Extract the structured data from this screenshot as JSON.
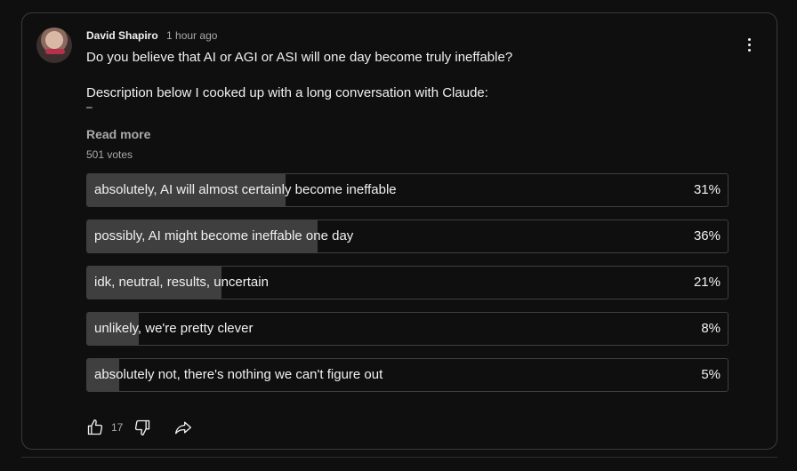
{
  "post": {
    "author": "David Shapiro",
    "time": "1 hour ago",
    "line1": "Do you believe that AI or AGI or ASI will one day become truly ineffable?",
    "line2": "Description below I cooked up with a long conversation with Claude:",
    "truncated": "–",
    "read_more": "Read more",
    "votes": "501 votes"
  },
  "poll": {
    "options": [
      {
        "label": "absolutely, AI will almost certainly become ineffable",
        "percent_text": "31%",
        "percent": 31
      },
      {
        "label": "possibly, AI might become ineffable one day",
        "percent_text": "36%",
        "percent": 36
      },
      {
        "label": "idk, neutral, results, uncertain",
        "percent_text": "21%",
        "percent": 21
      },
      {
        "label": "unlikely, we're pretty clever",
        "percent_text": "8%",
        "percent": 8
      },
      {
        "label": "absolutely not, there's nothing we can't figure out",
        "percent_text": "5%",
        "percent": 5
      }
    ]
  },
  "actions": {
    "like_count": "17",
    "icons": [
      "thumbs-up-icon",
      "thumbs-down-icon",
      "share-icon",
      "more-vert-icon"
    ]
  },
  "colors": {
    "background": "#0f0f0f",
    "border": "#3a3a3a",
    "bar_fill": "#3f3f3f",
    "text": "#f1f1f1",
    "muted": "#aaaaaa"
  }
}
